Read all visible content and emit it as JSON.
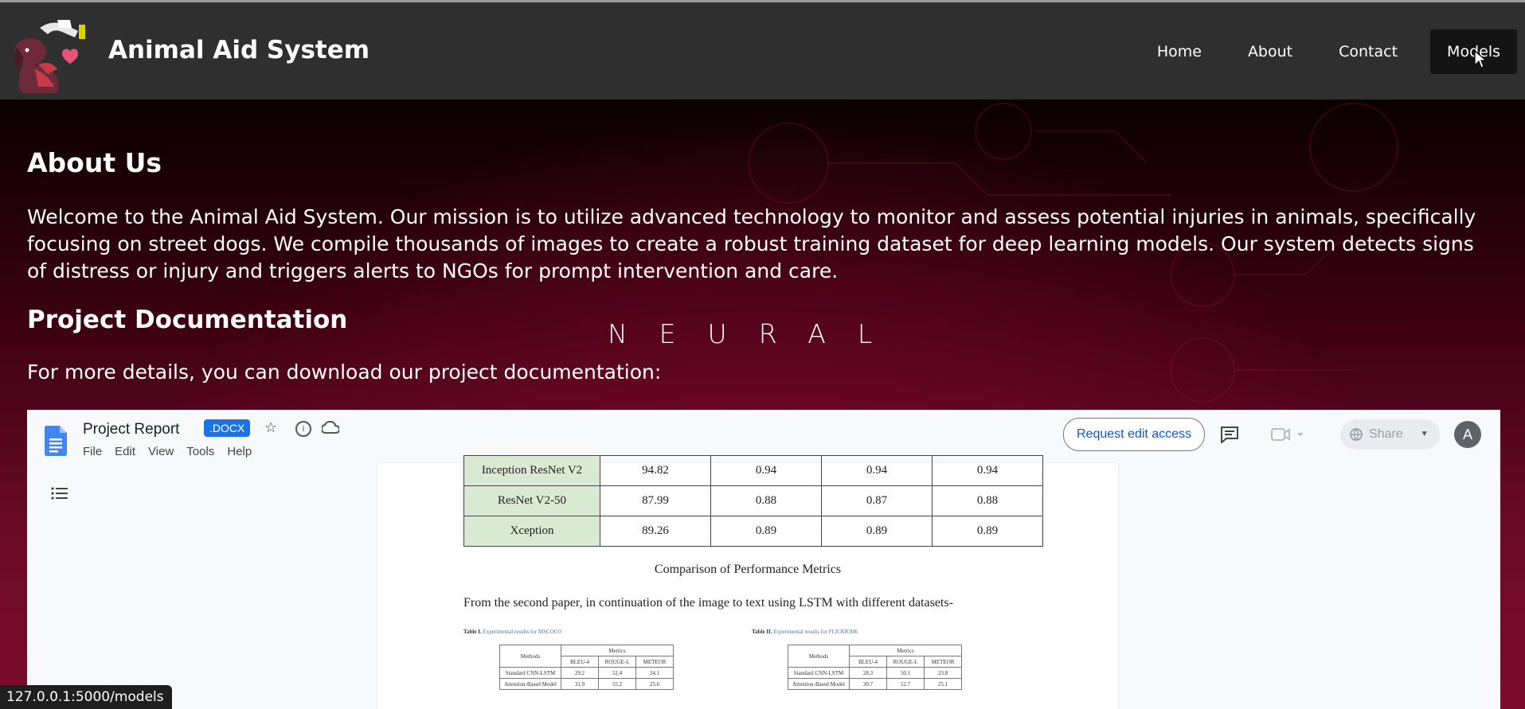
{
  "brand": {
    "name": "Animal Aid System",
    "colors": {
      "nav_bg": "#2f2f2f",
      "hero_dark": "#3a0012",
      "hero_red": "#8c0a32"
    }
  },
  "nav": {
    "home": "Home",
    "about": "About",
    "contact": "Contact",
    "models": "Models",
    "active": "Models"
  },
  "about": {
    "title": "About Us",
    "text": "Welcome to the Animal Aid System. Our mission is to utilize advanced technology to monitor and assess potential injuries in animals, specifically focusing on street dogs. We compile thousands of images to create a robust training dataset for deep learning models. Our system detects signs of distress or injury and triggers alerts to NGOs for prompt intervention and care."
  },
  "docs": {
    "title": "Project Documentation",
    "overlay": "NEURAL",
    "description": "For more details, you can download our project documentation:"
  },
  "viewer": {
    "title": "Project Report",
    "badge": ".DOCX",
    "menu": [
      "File",
      "Edit",
      "View",
      "Tools",
      "Help"
    ],
    "request_button": "Request edit access",
    "share_button": "Share",
    "avatar_letter": "A",
    "icons": [
      "google-docs-icon",
      "star-icon",
      "info-icon",
      "cloud-icon",
      "comment-icon",
      "video-icon",
      "globe-icon",
      "outline-list-icon"
    ],
    "table_rows": [
      {
        "model": "Inception ResNet V2",
        "values": [
          "94.82",
          "0.94",
          "0.94",
          "0.94"
        ]
      },
      {
        "model": "ResNet V2-50",
        "values": [
          "87.99",
          "0.88",
          "0.87",
          "0.88"
        ]
      },
      {
        "model": "Xception",
        "values": [
          "89.26",
          "0.89",
          "0.89",
          "0.89"
        ]
      }
    ],
    "caption": "Comparison of Performance Metrics",
    "paragraph": "From the second paper, in continuation of the image to text using LSTM with different datasets-",
    "mini_tables": [
      {
        "caption_label": "Table I.",
        "caption_text": "Experimental results for MSCOCO",
        "headers": [
          "Methods",
          "Metrics"
        ],
        "sub_headers": [
          "BLEU-4",
          "ROUGE-L",
          "METEOR"
        ],
        "rows": [
          {
            "method": "Standard CNN-LSTM",
            "values": [
              "29.2",
              "52.4",
              "24.1"
            ]
          },
          {
            "method": "Attention-Based Model",
            "values": [
              "31.9",
              "55.2",
              "25.6"
            ]
          }
        ]
      },
      {
        "caption_label": "Table II.",
        "caption_text": "Experimental results for FLICKR30K",
        "headers": [
          "Methods",
          "Metrics"
        ],
        "sub_headers": [
          "BLEU-4",
          "ROUGE-L",
          "METEOR"
        ],
        "rows": [
          {
            "method": "Standard CNN-LSTM",
            "values": [
              "28.3",
              "50.1",
              "23.8"
            ]
          },
          {
            "method": "Attention-Based Model",
            "values": [
              "30.7",
              "52.7",
              "25.1"
            ]
          }
        ]
      }
    ]
  },
  "status_url": "127.0.0.1:5000/models"
}
